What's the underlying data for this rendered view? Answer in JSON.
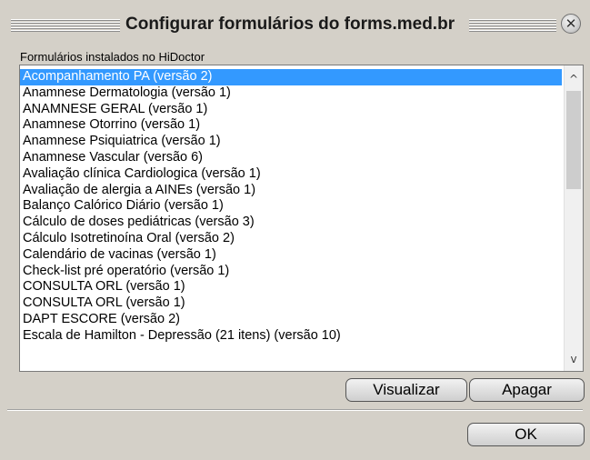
{
  "window": {
    "title": "Configurar formulários do forms.med.br",
    "close_glyph": "✕"
  },
  "list_label": "Formulários instalados no HiDoctor",
  "forms": [
    "Acompanhamento PA (versão 2)",
    "Anamnese Dermatologia (versão 1)",
    "ANAMNESE GERAL (versão 1)",
    "Anamnese Otorrino (versão 1)",
    "Anamnese Psiquiatrica (versão 1)",
    "Anamnese Vascular (versão 6)",
    "Avaliação clínica Cardiologica (versão 1)",
    "Avaliação de alergia a AINEs (versão 1)",
    "Balanço Calórico Diário (versão 1)",
    "Cálculo de doses pediátricas (versão 3)",
    "Cálculo Isotretinoína Oral (versão 2)",
    "Calendário de vacinas (versão 1)",
    "Check-list pré operatório (versão 1)",
    "CONSULTA ORL (versão 1)",
    "CONSULTA ORL (versão 1)",
    "DAPT ESCORE (versão 2)",
    "Escala de Hamilton - Depressão (21 itens) (versão 10)"
  ],
  "selected_index": 0,
  "scrollbar": {
    "up_glyph": "^",
    "down_glyph": "v"
  },
  "buttons": {
    "view": "Visualizar",
    "delete": "Apagar",
    "ok": "OK"
  },
  "colors": {
    "selection": "#3399ff",
    "dialog_bg": "#d4d0c8"
  },
  "icons": {
    "close": "close-icon",
    "scroll_up": "chevron-up-icon",
    "scroll_down": "chevron-down-icon"
  }
}
